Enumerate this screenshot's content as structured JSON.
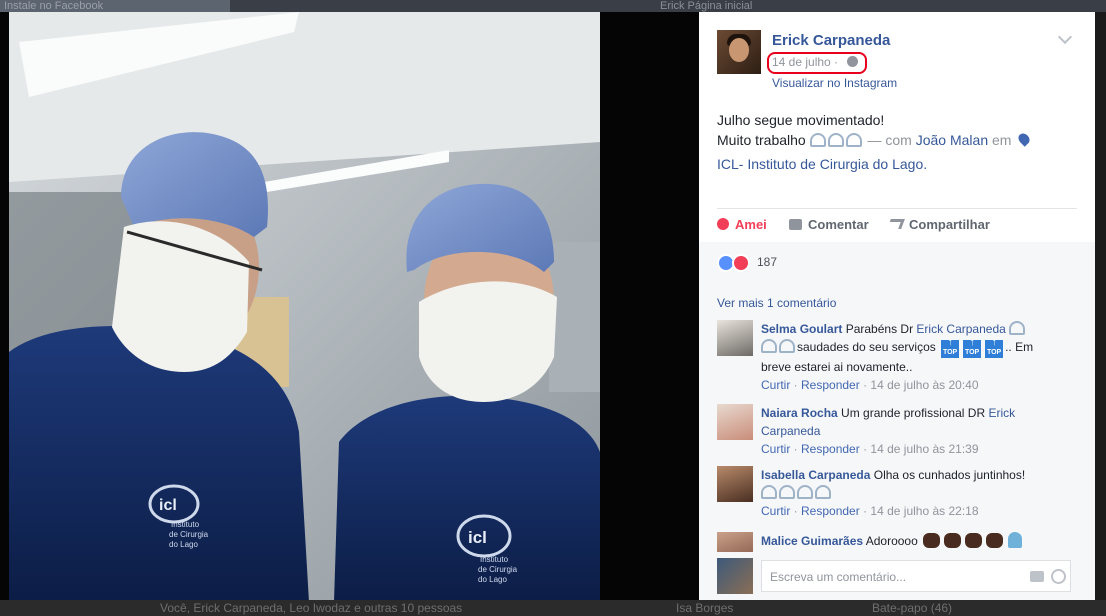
{
  "background": {
    "top_left_text": "Instale no Facebook",
    "top_right_text": "Erick   Página inicial",
    "bottom_friends_text": "Você, Erick Carpaneda, Leo Iwodaz e outras 10 pessoas",
    "bottom_name_text": "Isa Borges",
    "bottom_chat_text": "Bate-papo (46)"
  },
  "post": {
    "author": "Erick Carpaneda",
    "date": "14 de julho ·",
    "instagram_link": "Visualizar no Instagram",
    "line1": "Julho segue movimentado!",
    "line2_prefix": "Muito trabalho",
    "with_text": "— com",
    "tagged_person": "João Malan",
    "in_text": "em",
    "place": "ICL- Instituto de Cirurgia do Lago."
  },
  "photo": {
    "logo_text": "icl",
    "logo_subtext_1": "Instituto",
    "logo_subtext_2": "de Cirurgia",
    "logo_subtext_3": "do Lago"
  },
  "actions": {
    "love": "Amei",
    "comment": "Comentar",
    "share": "Compartilhar"
  },
  "reactions": {
    "count": "187"
  },
  "comments_header": {
    "more": "Ver mais 1 comentário"
  },
  "comments": [
    {
      "name": "Selma Goulart",
      "text_a": "Parabéns Dr",
      "tag": "Erick Carpaneda",
      "text_b": "saudades do seu serviços",
      "text_c": ".. Em breve estarei ai novamente..",
      "like": "Curtir",
      "reply": "Responder",
      "time": "· 14 de julho às 20:40"
    },
    {
      "name": "Naiara Rocha",
      "text_a": "Um grande profissional DR",
      "tag": "Erick Carpaneda",
      "like": "Curtir",
      "reply": "Responder",
      "time": "· 14 de julho às 21:39"
    },
    {
      "name": "Isabella Carpaneda",
      "text_a": "Olha os cunhados juntinhos!",
      "like": "Curtir",
      "reply": "Responder",
      "time": "· 14 de julho às 22:18"
    },
    {
      "name": "Malice Guimarães",
      "text_a": "Adoroooo"
    }
  ],
  "compose": {
    "placeholder": "Escreva um comentário..."
  },
  "colors": {
    "link": "#365899",
    "love": "#f33e58",
    "highlight_ring": "#e8001c",
    "scrub": "#8fa7c9"
  },
  "icons": [
    "globe-icon",
    "location-pin-icon",
    "heart-icon",
    "comment-icon",
    "share-icon",
    "like-reaction-icon",
    "love-reaction-icon",
    "camera-icon",
    "emoji-icon",
    "chevron-down-icon"
  ]
}
